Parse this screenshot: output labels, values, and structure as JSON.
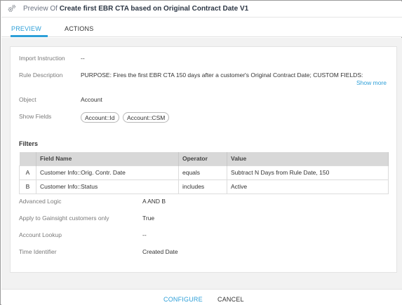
{
  "header": {
    "title_prefix": "Preview Of",
    "title_name": "Create first EBR CTA based on Original Contract Date V1",
    "icon": "gears-icon"
  },
  "tabs": [
    {
      "label": "PREVIEW",
      "active": true
    },
    {
      "label": "ACTIONS",
      "active": false
    }
  ],
  "details": {
    "import_instruction": {
      "label": "Import Instruction",
      "value": "--"
    },
    "rule_description": {
      "label": "Rule Description",
      "value": "PURPOSE: Fires the first EBR CTA 150 days after a customer's Original Contract Date; CUSTOM FIELDS:",
      "show_more": "Show more"
    },
    "object": {
      "label": "Object",
      "value": "Account"
    },
    "show_fields": {
      "label": "Show Fields",
      "chips": [
        "Account::Id",
        "Account::CSM"
      ]
    }
  },
  "filters": {
    "title": "Filters",
    "columns": [
      "Field Name",
      "Operator",
      "Value"
    ],
    "rows": [
      {
        "letter": "A",
        "field": "Customer Info::Orig. Contr. Date",
        "operator": "equals",
        "value": "Subtract N Days from Rule Date, 150"
      },
      {
        "letter": "B",
        "field": "Customer Info::Status",
        "operator": "includes",
        "value": "Active"
      }
    ]
  },
  "settings": [
    {
      "label": "Advanced Logic",
      "value": "A AND B"
    },
    {
      "label": "Apply to Gainsight customers only",
      "value": "True"
    },
    {
      "label": "Account Lookup",
      "value": "--"
    },
    {
      "label": "Time Identifier",
      "value": "Created Date"
    }
  ],
  "footer": {
    "configure_label": "CONFIGURE",
    "cancel_label": "CANCEL"
  },
  "colors": {
    "accent": "#2d9fd8",
    "table_header": "#d8d8d8",
    "body_background": "#f2f2f2"
  }
}
